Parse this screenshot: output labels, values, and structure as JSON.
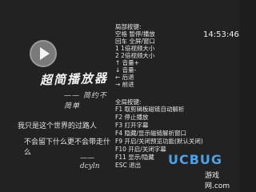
{
  "player": {
    "brand": "超简播放器",
    "tagline": "—— 简约不简单",
    "quote_line1": "我只是这个世界的过路人",
    "quote_line2": "不会留下什么更不会带走什么",
    "signature": "—— dcyln"
  },
  "clock": "14:53:46",
  "shortcuts": {
    "local_header": "局部按键:",
    "local": [
      "空格 暂停/播放",
      "回车 全屏/窗口",
      "1    1倍视频大小",
      "2    2倍视频大小",
      "↑  音量+",
      "↓  音量-",
      "←  后退",
      "→  前进"
    ],
    "global_header": "全局按键:",
    "global": [
      "F1 取剪辑板磁链自动解析",
      "F2 停止播放",
      "F3 打开字幕",
      "F4 隐藏/显示磁链解析窗口",
      "F9 开启/关闭预览功能(默认关闭)",
      "F10 开启/关闭字幕",
      "F11 显示/隐藏",
      "ESC 退出"
    ]
  },
  "watermark": {
    "text": "UCBUG",
    "sub": "游戏网.com"
  }
}
